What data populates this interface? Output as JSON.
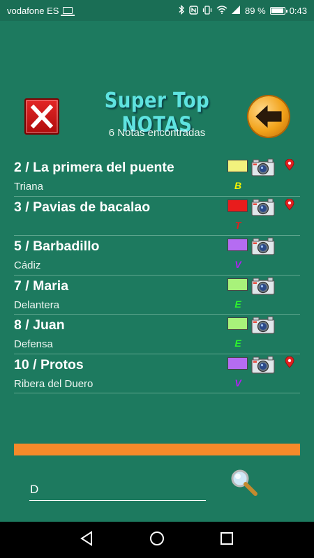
{
  "status_bar": {
    "carrier": "vodafone ES",
    "battery": "89 %",
    "time": "0:43",
    "icons": [
      "laptop-icon",
      "bluetooth-icon",
      "nfc-icon",
      "vibrate-icon",
      "wifi-icon",
      "signal-icon",
      "battery-icon"
    ]
  },
  "header": {
    "title": "Super Top NOTAS",
    "count_text": "6 Notas encontradas"
  },
  "notes": [
    {
      "title": "2 / La primera del puente",
      "subtitle": "Triana",
      "color": "#f2f27d",
      "letter": "B",
      "letter_color": "#f2f200",
      "has_location": true
    },
    {
      "title": "3 / Pavias de bacalao",
      "subtitle": "",
      "color": "#e81c1c",
      "letter": "T",
      "letter_color": "#e81c1c",
      "has_location": true
    },
    {
      "title": "5 / Barbadillo",
      "subtitle": "Cádiz",
      "color": "#b56cf2",
      "letter": "V",
      "letter_color": "#b020f2",
      "has_location": false
    },
    {
      "title": "7 / Maria",
      "subtitle": "Delantera",
      "color": "#a8f27a",
      "letter": "E",
      "letter_color": "#2ef22e",
      "has_location": false
    },
    {
      "title": "8 / Juan",
      "subtitle": "Defensa",
      "color": "#a8f27a",
      "letter": "E",
      "letter_color": "#2ef22e",
      "has_location": false
    },
    {
      "title": "10 / Protos",
      "subtitle": "Ribera del Duero",
      "color": "#b56cf2",
      "letter": "V",
      "letter_color": "#b020f2",
      "has_location": true
    }
  ],
  "search": {
    "value": "D"
  },
  "colors": {
    "background": "#1d7a5f",
    "status_bar": "#1a6e55",
    "progress": "#f58a2a",
    "title": "#5fe3e0"
  }
}
